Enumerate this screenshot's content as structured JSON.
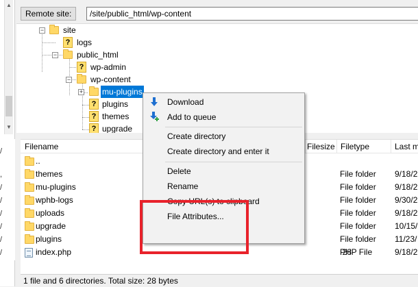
{
  "remote_bar": {
    "label": "Remote site:",
    "path": "/site/public_html/wp-content"
  },
  "tree": {
    "nodes": [
      {
        "label": "site",
        "icon": "folder-icon"
      },
      {
        "label": "logs",
        "icon": "unknown-folder-icon"
      },
      {
        "label": "public_html",
        "icon": "folder-icon"
      },
      {
        "label": "wp-admin",
        "icon": "unknown-folder-icon"
      },
      {
        "label": "wp-content",
        "icon": "folder-icon"
      },
      {
        "label": "mu-plugins",
        "icon": "folder-icon",
        "selected": true
      },
      {
        "label": "plugins",
        "icon": "unknown-folder-icon"
      },
      {
        "label": "themes",
        "icon": "unknown-folder-icon"
      },
      {
        "label": "upgrade",
        "icon": "unknown-folder-icon"
      }
    ]
  },
  "filelist": {
    "columns": {
      "filename": "Filename",
      "filesize": "Filesize",
      "filetype": "Filetype",
      "modified": "Last m"
    },
    "rows": [
      {
        "name": "..",
        "size": "",
        "type": "",
        "modified": ""
      },
      {
        "name": "themes",
        "size": "",
        "type": "File folder",
        "modified": "9/18/2"
      },
      {
        "name": "mu-plugins",
        "size": "",
        "type": "File folder",
        "modified": "9/18/2"
      },
      {
        "name": "wphb-logs",
        "size": "",
        "type": "File folder",
        "modified": "9/30/2"
      },
      {
        "name": "uploads",
        "size": "",
        "type": "File folder",
        "modified": "9/18/2"
      },
      {
        "name": "upgrade",
        "size": "",
        "type": "File folder",
        "modified": "10/15/"
      },
      {
        "name": "plugins",
        "size": "",
        "type": "File folder",
        "modified": "11/23/"
      },
      {
        "name": "index.php",
        "size": "28",
        "type": "PHP File",
        "modified": "9/18/2"
      }
    ]
  },
  "status": {
    "text": "1 file and 6 directories. Total size: 28 bytes"
  },
  "context_menu": {
    "items": [
      {
        "label": "Download",
        "icon": "download-icon"
      },
      {
        "label": "Add to queue",
        "icon": "add-to-queue-icon"
      },
      {
        "label": "Create directory"
      },
      {
        "label": "Create directory and enter it"
      },
      {
        "label": "Delete"
      },
      {
        "label": "Rename"
      },
      {
        "label": "Copy URL(s) to clipboard"
      },
      {
        "label": "File Attributes..."
      }
    ]
  },
  "left_pane": {
    "row_fragments": [
      "/",
      ",",
      "/",
      "/",
      "/",
      "/",
      "/",
      "/"
    ]
  },
  "colors": {
    "selection": "#0078d7",
    "highlight_box": "#e8222b",
    "folder": "#ffd867"
  }
}
